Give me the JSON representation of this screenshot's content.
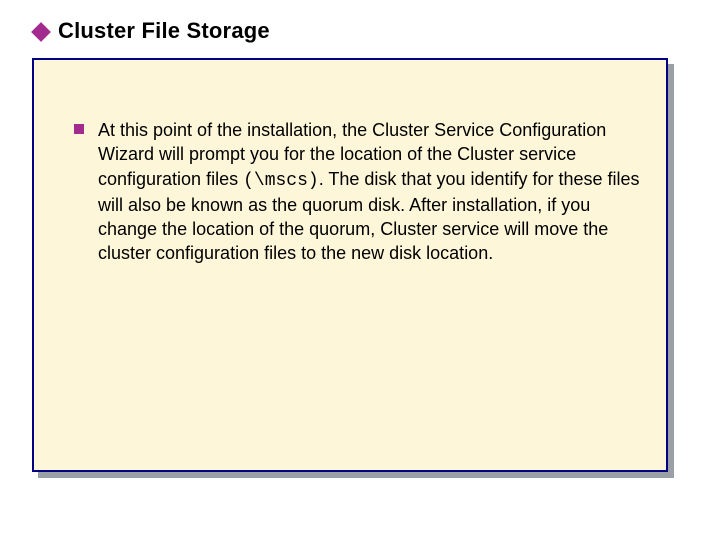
{
  "title": "Cluster File Storage",
  "body_pre": "At this point of the installation, the Cluster Service Configuration Wizard will prompt you for the location of the Cluster service configuration files ",
  "body_code": "(\\mscs)",
  "body_post": ". The disk that you identify for these files will also be known as the quorum disk. After installation, if you change the location of the quorum, Cluster service will move the cluster configuration files to the new disk location.",
  "colors": {
    "accent": "#a32b8f",
    "panel_bg": "#fdf6d8",
    "panel_border": "#000080",
    "shadow": "#9aa0a6"
  }
}
